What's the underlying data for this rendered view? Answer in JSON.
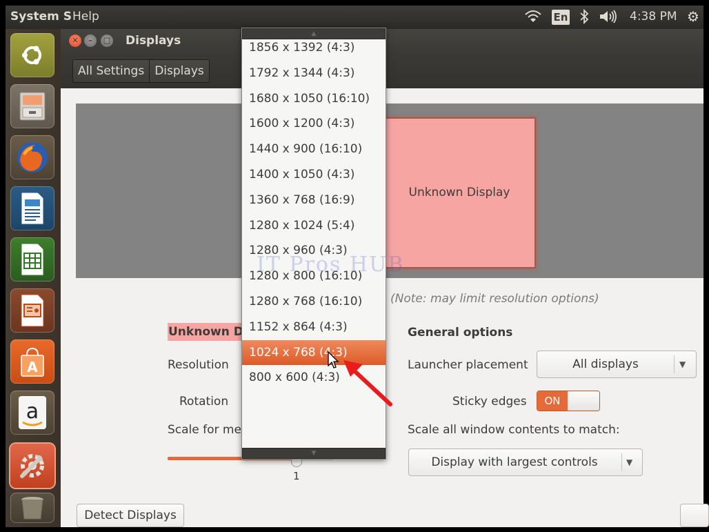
{
  "topbar": {
    "app_name": "System S",
    "menu_help": "Help",
    "keyboard_lang": "En",
    "clock": "4:38 PM"
  },
  "launcher": {
    "items": [
      "ubuntu-dash",
      "files",
      "firefox",
      "libreoffice-writer",
      "libreoffice-calc",
      "libreoffice-impress",
      "ubuntu-software",
      "amazon",
      "system-settings",
      "trash"
    ]
  },
  "window": {
    "title": "Displays",
    "breadcrumbs": [
      "All Settings",
      "Displays"
    ]
  },
  "preview": {
    "monitor_label": "Unknown Display"
  },
  "note": "(Note: may limit resolution options)",
  "display_section": {
    "header": "Unknown Di",
    "resolution_label": "Resolution",
    "rotation_label": "Rotation",
    "scale_label": "Scale for me",
    "scale_value": "1"
  },
  "general": {
    "header": "General options",
    "launcher_placement_label": "Launcher placement",
    "launcher_placement_value": "All displays",
    "sticky_edges_label": "Sticky edges",
    "sticky_edges_state": "ON",
    "scale_all_label": "Scale all window contents to match:",
    "scale_all_value": "Display with largest controls"
  },
  "buttons": {
    "detect_displays": "Detect Displays"
  },
  "resolution_menu": {
    "options": [
      "1856 x 1392 (4:3)",
      "1792 x 1344 (4:3)",
      "1680 x 1050 (16:10)",
      "1600 x 1200 (4:3)",
      "1440 x 900 (16:10)",
      "1400 x 1050 (4:3)",
      "1360 x 768 (16:9)",
      "1280 x 1024 (5:4)",
      "1280 x 960 (4:3)",
      "1280 x 800 (16:10)",
      "1280 x 768 (16:10)",
      "1152 x 864 (4:3)",
      "1024 x 768 (4:3)",
      "800 x 600 (4:3)"
    ],
    "highlighted": "1024 x 768 (4:3)"
  },
  "watermark": "IT Pros HUB",
  "colors": {
    "accent": "#e46a3a",
    "monitor_fill": "#f6a5a3",
    "panel": "#3c3b37"
  }
}
